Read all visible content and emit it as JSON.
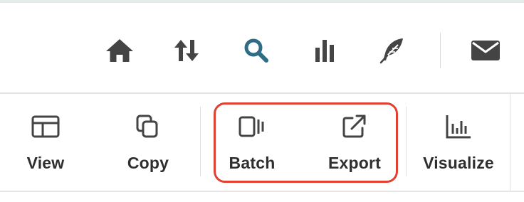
{
  "colors": {
    "icon_gray": "#444444",
    "search_active": "#2f6d86",
    "highlight_red": "#e04131",
    "label_text": "#2f2f2f"
  },
  "nav": {
    "icons": [
      {
        "name": "home-icon"
      },
      {
        "name": "sort-arrows-icon"
      },
      {
        "name": "search-icon",
        "active": true
      },
      {
        "name": "bar-chart-icon"
      },
      {
        "name": "feather-icon"
      },
      {
        "name": "mail-icon"
      }
    ]
  },
  "toolbar": {
    "items": [
      {
        "id": "view",
        "label": "View",
        "icon": "view-layout-icon"
      },
      {
        "id": "copy",
        "label": "Copy",
        "icon": "copy-icon"
      },
      {
        "id": "batch",
        "label": "Batch",
        "icon": "batch-icon"
      },
      {
        "id": "export",
        "label": "Export",
        "icon": "export-icon"
      },
      {
        "id": "visualize",
        "label": "Visualize",
        "icon": "visualize-chart-icon"
      }
    ]
  }
}
